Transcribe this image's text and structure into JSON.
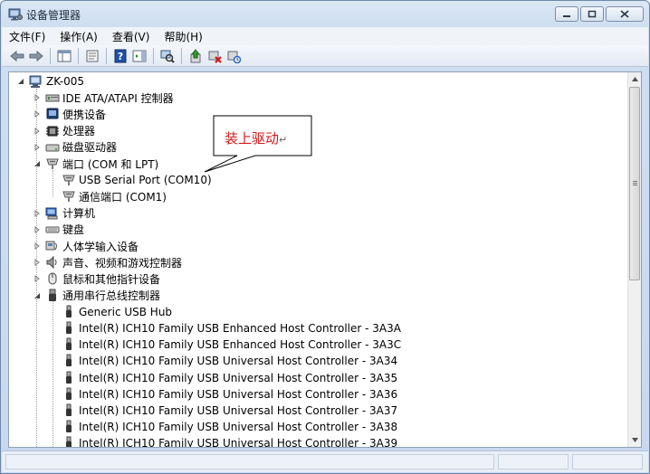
{
  "window": {
    "title": "设备管理器",
    "buttons": {
      "minimize": "▭",
      "maximize": "□",
      "close": "✕"
    }
  },
  "menu": [
    "文件(F)",
    "操作(A)",
    "查看(V)",
    "帮助(H)"
  ],
  "toolbar": [
    "back-icon",
    "forward-icon",
    "properties-view-icon",
    "properties-icon",
    "help-icon",
    "action-pane-icon",
    "scan-hardware-icon",
    "update-driver-icon",
    "uninstall-icon",
    "disable-icon"
  ],
  "tree": {
    "root": "ZK-005",
    "categories": [
      {
        "label": "IDE ATA/ATAPI 控制器",
        "expanded": false
      },
      {
        "label": "便携设备",
        "expanded": false
      },
      {
        "label": "处理器",
        "expanded": false
      },
      {
        "label": "磁盘驱动器",
        "expanded": false
      },
      {
        "label": "端口 (COM 和 LPT)",
        "expanded": true
      },
      {
        "label": "计算机",
        "expanded": false
      },
      {
        "label": "键盘",
        "expanded": false
      },
      {
        "label": "人体学输入设备",
        "expanded": false
      },
      {
        "label": "声音、视频和游戏控制器",
        "expanded": false
      },
      {
        "label": "鼠标和其他指针设备",
        "expanded": false
      },
      {
        "label": "通用串行总线控制器",
        "expanded": true
      }
    ],
    "ports_children": [
      "USB Serial Port (COM10)",
      "通信端口 (COM1)"
    ],
    "usb_children": [
      "Generic USB Hub",
      "Intel(R) ICH10 Family USB Enhanced Host Controller - 3A3A",
      "Intel(R) ICH10 Family USB Enhanced Host Controller - 3A3C",
      "Intel(R) ICH10 Family USB Universal Host Controller - 3A34",
      "Intel(R) ICH10 Family USB Universal Host Controller - 3A35",
      "Intel(R) ICH10 Family USB Universal Host Controller - 3A36",
      "Intel(R) ICH10 Family USB Universal Host Controller - 3A37",
      "Intel(R) ICH10 Family USB Universal Host Controller - 3A38",
      "Intel(R) ICH10 Family USB Universal Host Controller - 3A39"
    ]
  },
  "callout": {
    "text": "装上驱动",
    "mark": "↵"
  },
  "colors": {
    "callout_text": "#d21a1a",
    "title_gradient_top": "#dbe7f5"
  }
}
